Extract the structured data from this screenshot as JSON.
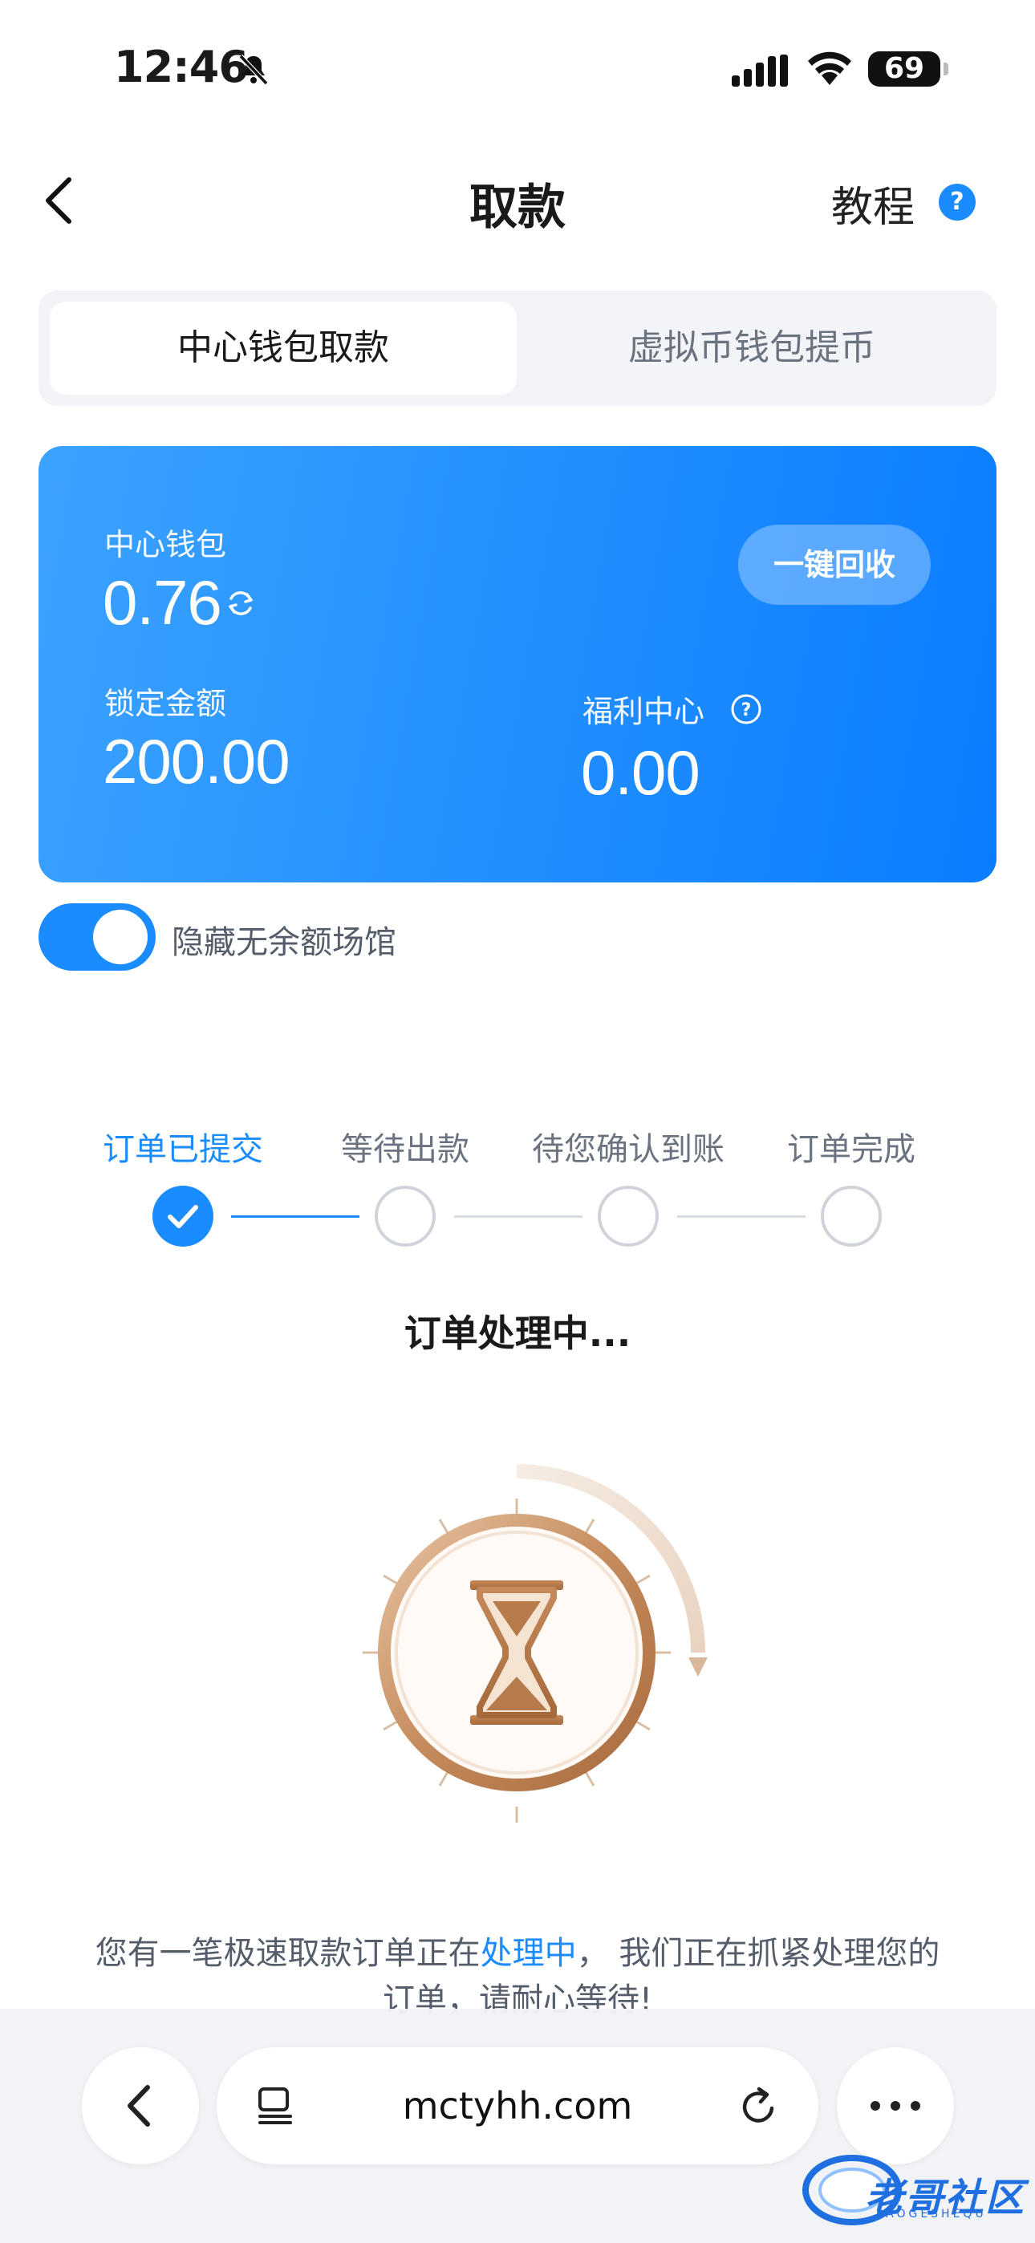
{
  "status_bar": {
    "time": "12:46",
    "battery": "69"
  },
  "nav": {
    "title": "取款",
    "tutorial": "教程",
    "help": "?"
  },
  "tabs": [
    {
      "label": "中心钱包取款",
      "active": true
    },
    {
      "label": "虚拟币钱包提币",
      "active": false
    }
  ],
  "wallet": {
    "center_label": "中心钱包",
    "center_value": "0.76",
    "recycle_button": "一键回收",
    "locked_label": "锁定金额",
    "locked_value": "200.00",
    "welfare_label": "福利中心",
    "welfare_value": "0.00"
  },
  "toggle": {
    "label": "隐藏无余额场馆",
    "on": true
  },
  "steps": [
    {
      "label": "订单已提交",
      "done": true
    },
    {
      "label": "等待出款",
      "done": false
    },
    {
      "label": "待您确认到账",
      "done": false
    },
    {
      "label": "订单完成",
      "done": false
    }
  ],
  "processing": {
    "title": "订单处理中..."
  },
  "notice": {
    "prefix": "您有一笔极速取款订单正在",
    "highlight": "处理中",
    "suffix": "， 我们正在抓紧处理您的订单，请耐心等待!"
  },
  "browser": {
    "url": "mctyhh.com"
  },
  "watermark": {
    "text": "老哥社区",
    "sub": "LAOGESHEQU"
  },
  "colors": {
    "accent": "#1a8cff",
    "card_start": "#3ba2ff",
    "card_end": "#0a7dff"
  }
}
